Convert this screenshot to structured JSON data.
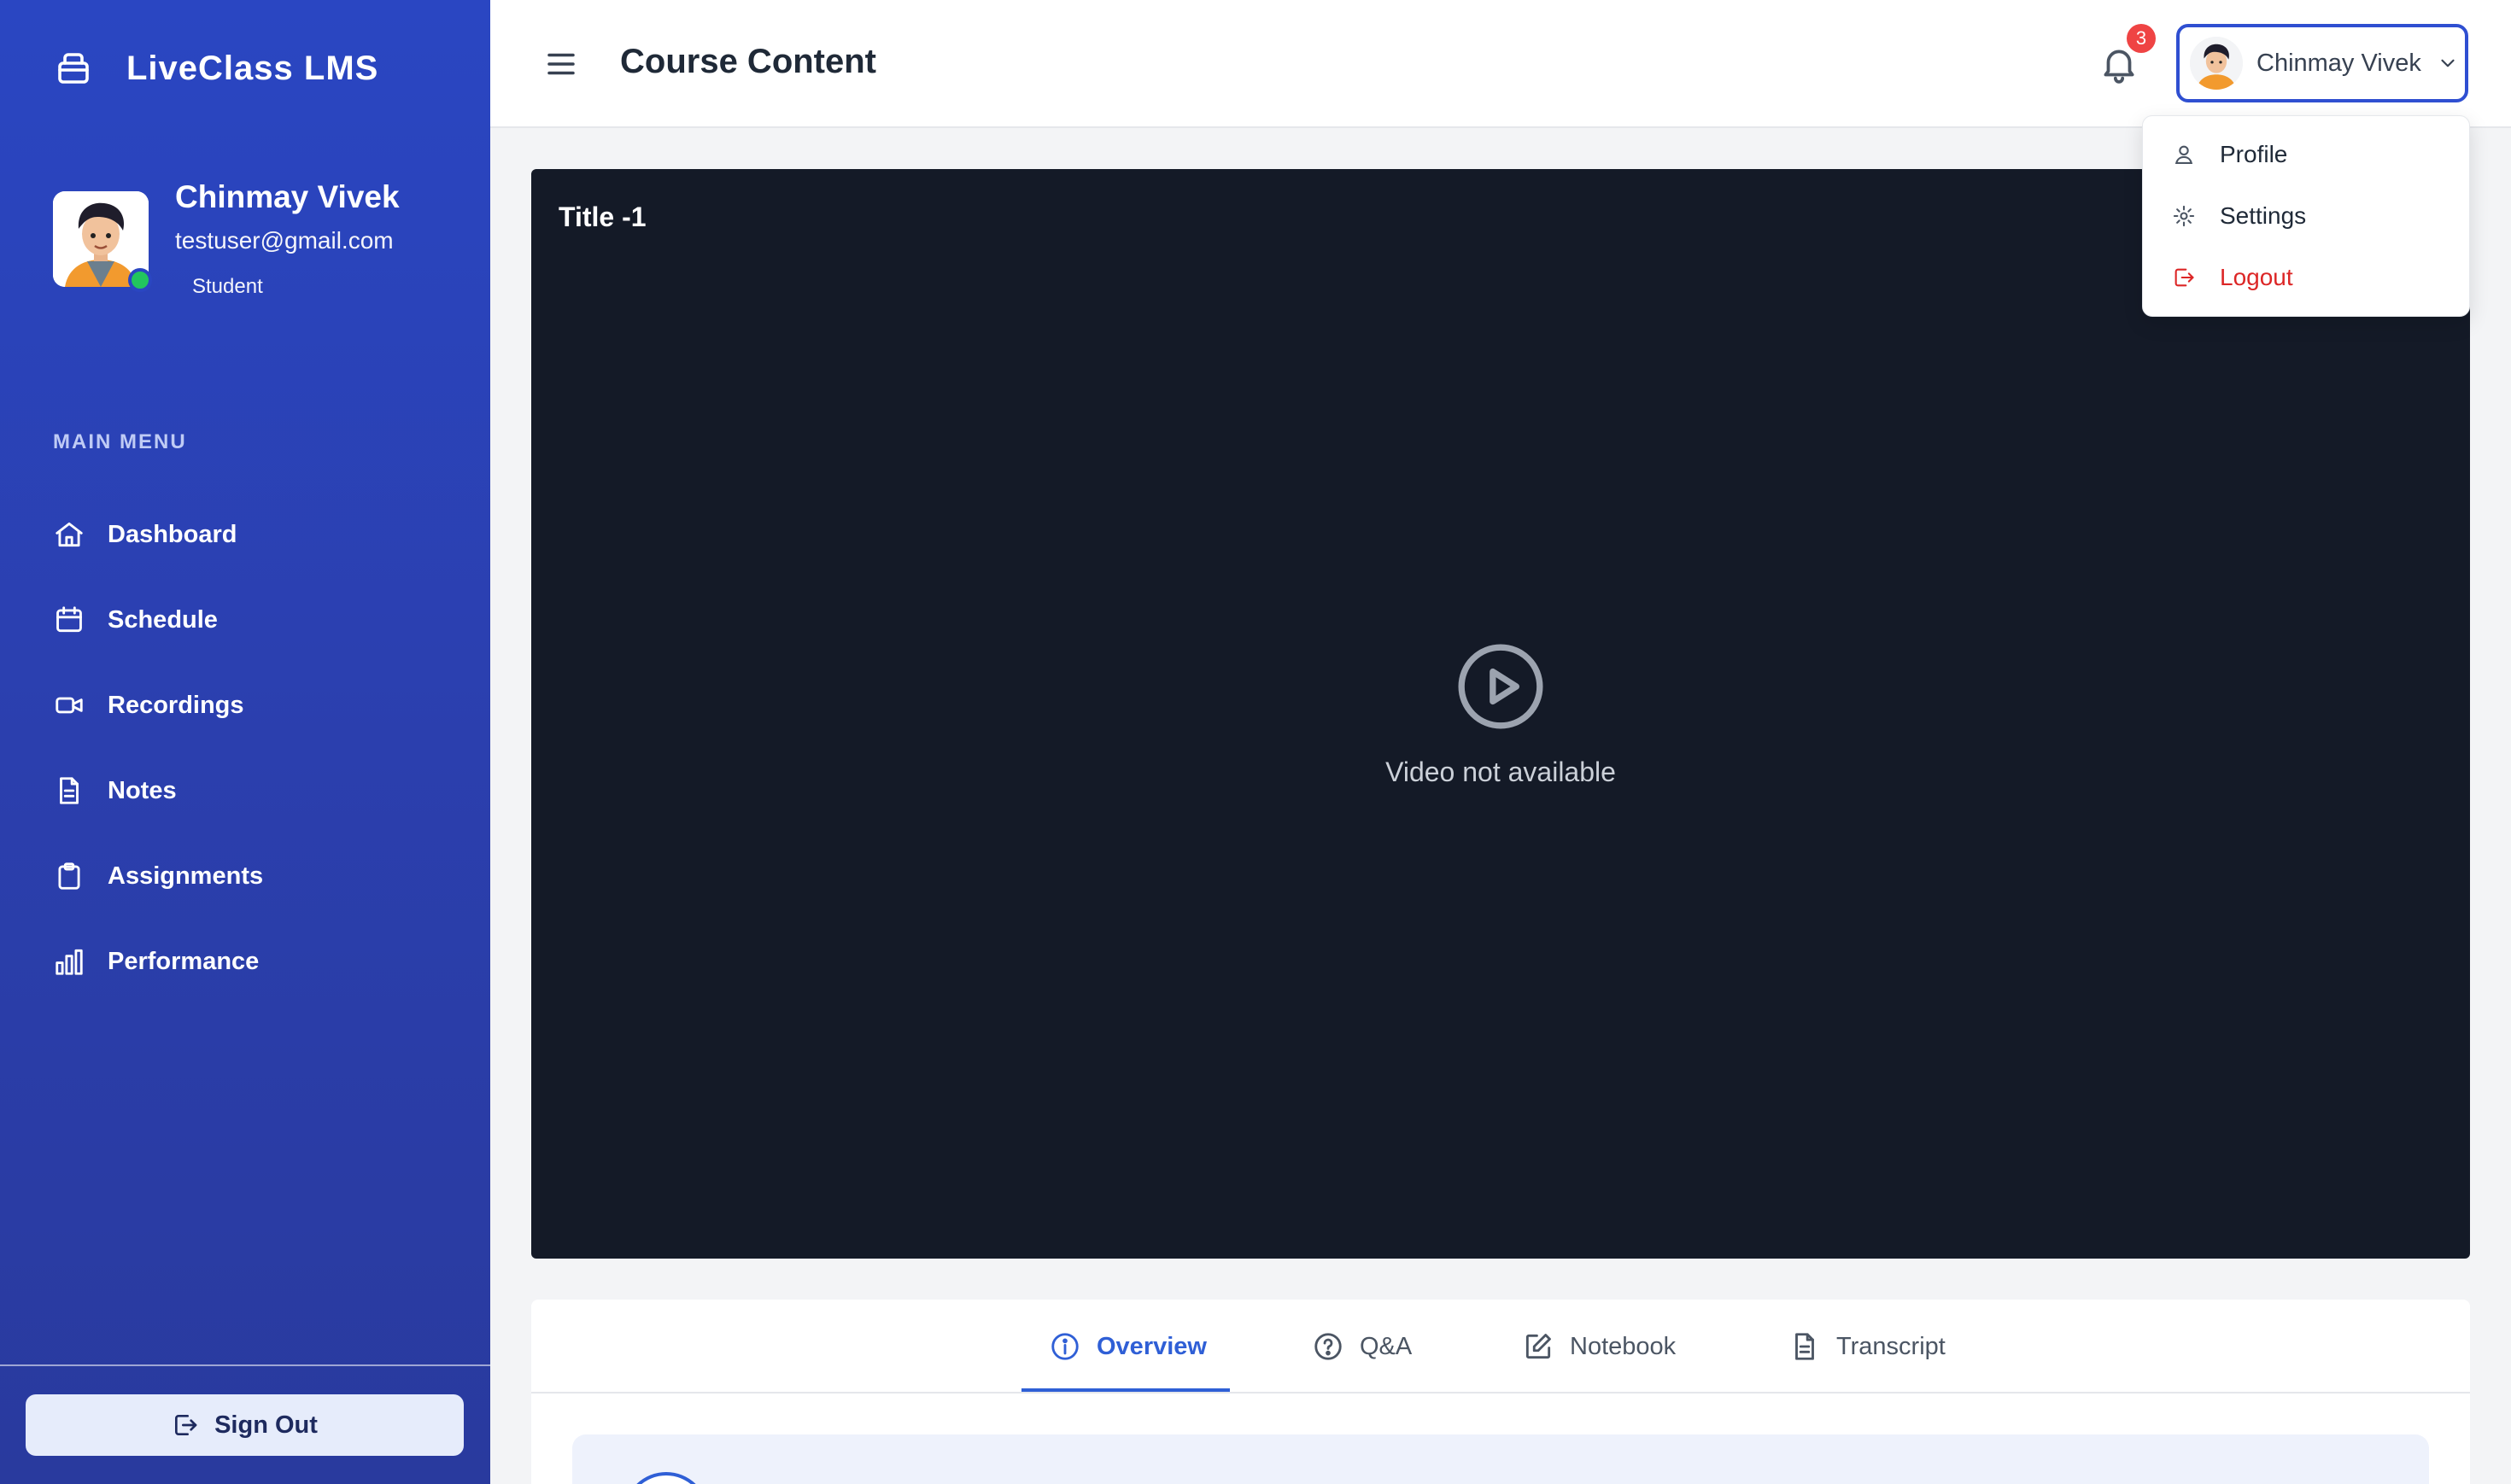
{
  "app": {
    "brand": "LiveClass LMS"
  },
  "user": {
    "name": "Chinmay Vivek",
    "email": "testuser@gmail.com",
    "role": "Student",
    "online": true
  },
  "sidebar": {
    "menu_title": "MAIN MENU",
    "items": [
      {
        "label": "Dashboard",
        "icon": "home-icon"
      },
      {
        "label": "Schedule",
        "icon": "calendar-icon"
      },
      {
        "label": "Recordings",
        "icon": "video-camera-icon"
      },
      {
        "label": "Notes",
        "icon": "document-icon"
      },
      {
        "label": "Assignments",
        "icon": "clipboard-icon"
      },
      {
        "label": "Performance",
        "icon": "bar-chart-icon"
      }
    ],
    "sign_out": "Sign Out"
  },
  "header": {
    "title": "Course Content",
    "notification_count": "3",
    "user_button": "Chinmay Vivek"
  },
  "dropdown": [
    {
      "label": "Profile",
      "icon": "user-icon"
    },
    {
      "label": "Settings",
      "icon": "gear-icon"
    },
    {
      "label": "Logout",
      "icon": "logout-icon"
    }
  ],
  "video": {
    "title": "Title -1",
    "message": "Video not available"
  },
  "tabs": [
    {
      "label": "Overview",
      "icon": "info-icon",
      "active": true
    },
    {
      "label": "Q&A",
      "icon": "question-icon",
      "active": false
    },
    {
      "label": "Notebook",
      "icon": "pencil-square-icon",
      "active": false
    },
    {
      "label": "Transcript",
      "icon": "file-icon",
      "active": false
    }
  ],
  "colors": {
    "sidebar": "#2a46c2",
    "accent": "#2f5fd6",
    "video_bg": "#141a27",
    "badge": "#ef4444",
    "logout": "#dc2626",
    "online": "#22c55e"
  }
}
